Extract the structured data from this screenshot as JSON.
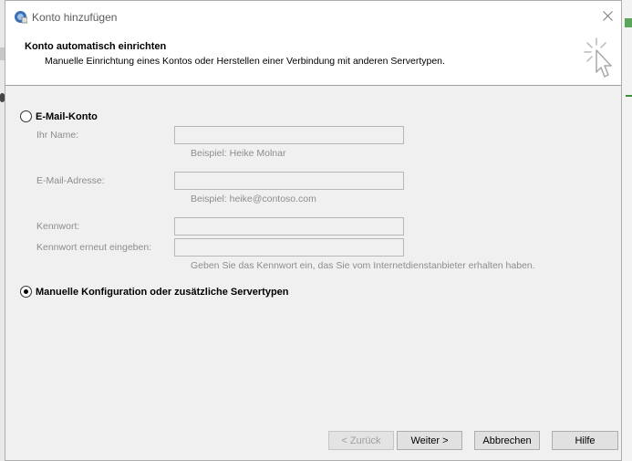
{
  "window": {
    "title": "Konto hinzufügen"
  },
  "header": {
    "title": "Konto automatisch einrichten",
    "subtitle": "Manuelle Einrichtung eines Kontos oder Herstellen einer Verbindung mit anderen Servertypen."
  },
  "email_option": {
    "label": "E-Mail-Konto",
    "selected": false
  },
  "fields": {
    "name_label": "Ihr Name:",
    "name_value": "",
    "name_hint": "Beispiel: Heike Molnar",
    "email_label": "E-Mail-Adresse:",
    "email_value": "",
    "email_hint": "Beispiel: heike@contoso.com",
    "password_label": "Kennwort:",
    "password_value": "",
    "password_repeat_label": "Kennwort erneut eingeben:",
    "password_repeat_value": "",
    "password_hint": "Geben Sie das Kennwort ein, das Sie vom Internetdienstanbieter erhalten haben."
  },
  "manual_option": {
    "label": "Manuelle Konfiguration oder zusätzliche Servertypen",
    "selected": true
  },
  "buttons": {
    "back": "< Zurück",
    "next": "Weiter >",
    "cancel": "Abbrechen",
    "help": "Hilfe"
  },
  "icons": {
    "app": "outlook-icon",
    "close": "close-icon",
    "wizard": "cursor-click-icon"
  }
}
